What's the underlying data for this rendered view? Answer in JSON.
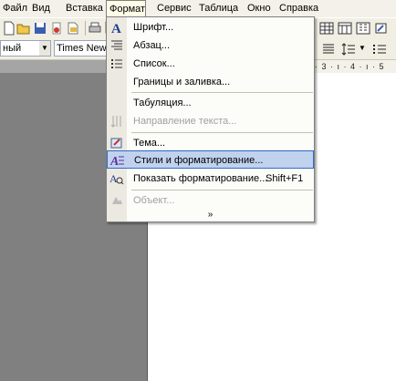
{
  "menubar": {
    "items": [
      "Файл",
      "Вид",
      "Вставка",
      "Формат",
      "Сервис",
      "Таблица",
      "Окно",
      "Справка"
    ]
  },
  "toolbar": {
    "style_value": "ный",
    "font_value": "Times New R"
  },
  "ruler": {
    "text": "· 3 · ı · 4 · ı · 5"
  },
  "format_menu": {
    "items": [
      {
        "label": "Шрифт...",
        "icon": "font-icon",
        "enabled": true
      },
      {
        "label": "Абзац...",
        "icon": "paragraph-icon",
        "enabled": true
      },
      {
        "label": "Список...",
        "icon": "list-icon",
        "enabled": true
      },
      {
        "label": "Границы и заливка...",
        "icon": "",
        "enabled": true
      },
      {
        "label": "Табуляция...",
        "icon": "",
        "enabled": true
      },
      {
        "label": "Направление текста...",
        "icon": "text-direction-icon",
        "enabled": false
      },
      {
        "label": "Тема...",
        "icon": "theme-icon",
        "enabled": true
      },
      {
        "label": "Стили и форматирование...",
        "icon": "styles-icon",
        "enabled": true,
        "highlighted": true
      },
      {
        "label": "Показать форматирование...",
        "shortcut": "Shift+F1",
        "icon": "reveal-formatting-icon",
        "enabled": true
      },
      {
        "label": "Объект...",
        "icon": "object-icon",
        "enabled": false
      }
    ],
    "expand_glyph": "»"
  }
}
